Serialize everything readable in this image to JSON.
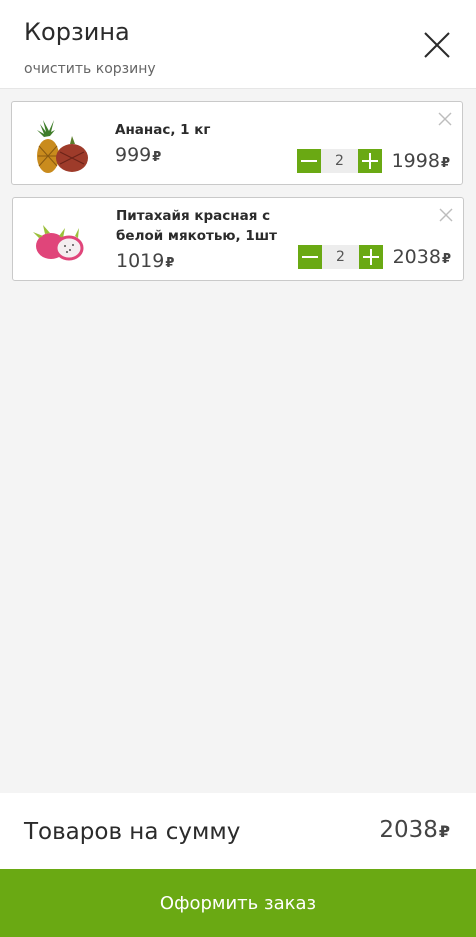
{
  "header": {
    "title": "Корзина",
    "clear_label": "очистить корзину",
    "close_icon": "close-icon"
  },
  "currency": "₽",
  "items": [
    {
      "name": "Ананас, 1 кг",
      "price": "999",
      "quantity": "2",
      "total": "1998",
      "image": "pineapple-image"
    },
    {
      "name": "Питахайя красная с белой мякотью, 1шт",
      "price": "1019",
      "quantity": "2",
      "total": "2038",
      "image": "dragon-fruit-image"
    }
  ],
  "summary": {
    "label": "Товаров на сумму",
    "total": "2038"
  },
  "checkout_label": "Оформить заказ",
  "colors": {
    "accent": "#6aa913",
    "background": "#f4f4f4"
  }
}
